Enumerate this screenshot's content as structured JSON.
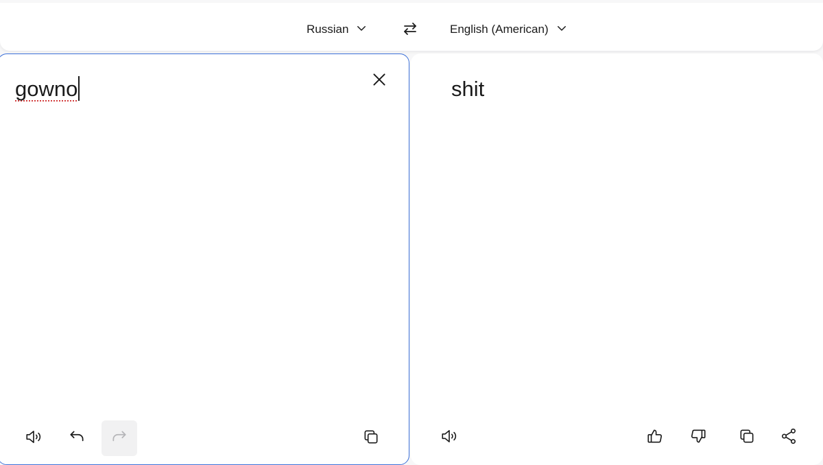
{
  "language_bar": {
    "source_language": "Russian",
    "target_language": "English (American)"
  },
  "source": {
    "text": "gowno"
  },
  "target": {
    "text": "shit"
  },
  "icons": {
    "source_speaker": "speaker-icon",
    "undo": "undo-icon",
    "redo": "redo-icon",
    "source_copy": "copy-icon",
    "clear": "close-icon",
    "swap": "swap-icon",
    "target_speaker": "speaker-icon",
    "thumbs_up": "thumbs-up-icon",
    "thumbs_down": "thumbs-down-icon",
    "target_copy": "copy-icon",
    "share": "share-icon"
  },
  "colors": {
    "accent_border": "#3b6fd8",
    "spellcheck_underline": "#d23c3c",
    "background": "#f7f7f8"
  }
}
